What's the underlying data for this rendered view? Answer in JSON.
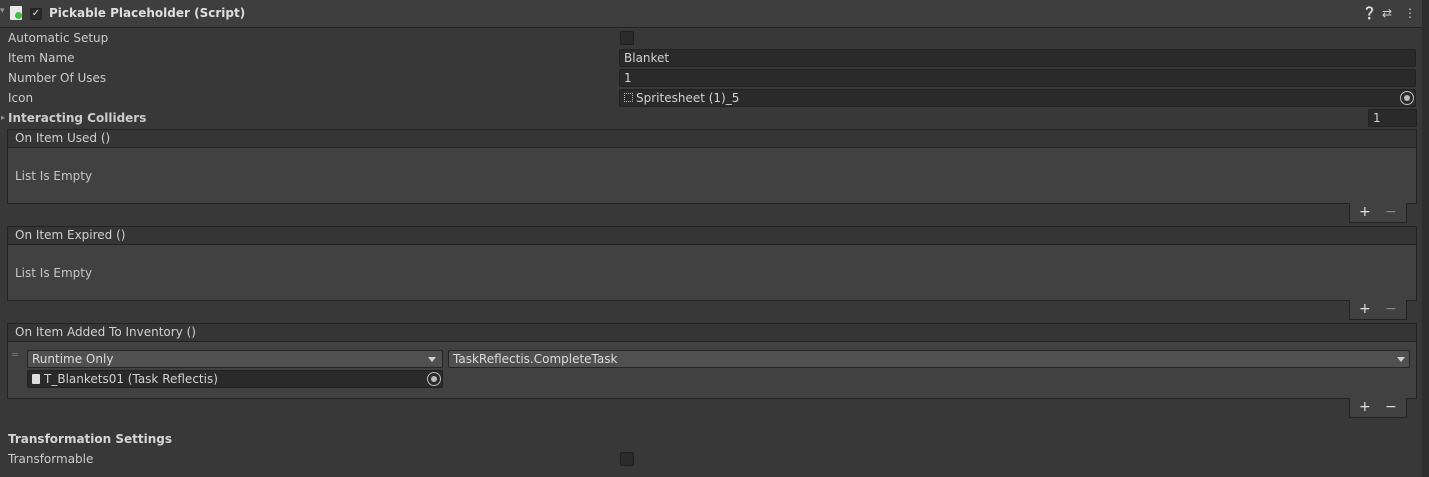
{
  "component": {
    "title": "Pickable Placeholder (Script)",
    "enabled_check": "✓",
    "help_icon": "help-icon",
    "presets_icon": "presets-icon",
    "menu_icon": "menu-icon"
  },
  "fields": {
    "automatic_setup_label": "Automatic Setup",
    "item_name_label": "Item Name",
    "item_name_value": "Blanket",
    "uses_label": "Number Of Uses",
    "uses_value": "1",
    "icon_label": "Icon",
    "icon_value": "Spritesheet (1)_5",
    "colliders_label": "Interacting Colliders",
    "colliders_count": "1"
  },
  "events": {
    "used_title": "On Item Used ()",
    "used_empty": "List Is Empty",
    "expired_title": "On Item Expired ()",
    "expired_empty": "List Is Empty",
    "added_title": "On Item Added To Inventory ()",
    "added_mode": "Runtime Only",
    "added_function": "TaskReflectis.CompleteTask",
    "added_object": "T_Blankets01 (Task Reflectis)",
    "plus": "+",
    "minus": "−"
  },
  "transformation": {
    "section_title": "Transformation Settings",
    "transformable_label": "Transformable"
  },
  "colors": {
    "background": "#383838",
    "field_bg": "#2a2a2a",
    "header_bg": "#3e3e3e"
  }
}
